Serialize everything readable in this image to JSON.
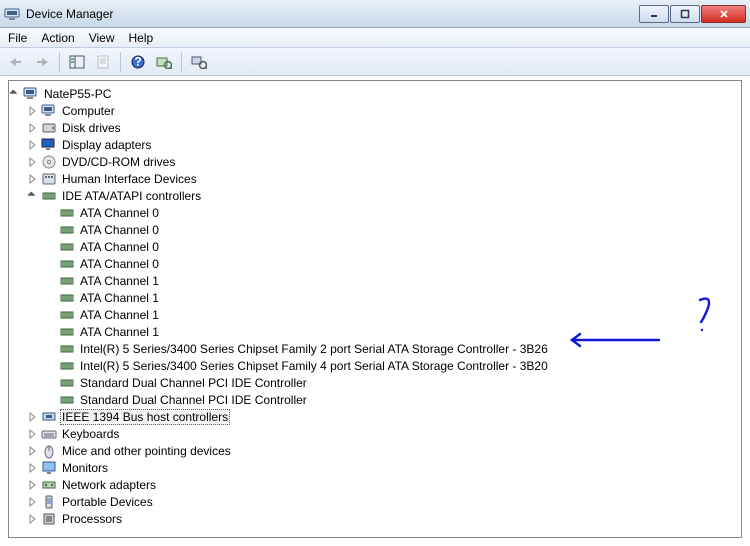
{
  "window": {
    "title": "Device Manager"
  },
  "menubar": {
    "items": [
      "File",
      "Action",
      "View",
      "Help"
    ]
  },
  "toolbar": {
    "back": "Back",
    "forward": "Forward",
    "show_hide": "Show/Hide Console Tree",
    "properties": "Properties",
    "help": "Help",
    "scan": "Scan for hardware changes",
    "view_devices": "View"
  },
  "tree": {
    "root": {
      "label": "NateP55-PC",
      "icon": "computer"
    },
    "nodes": [
      {
        "label": "Computer",
        "icon": "computer",
        "expanded": false
      },
      {
        "label": "Disk drives",
        "icon": "disk",
        "expanded": false
      },
      {
        "label": "Display adapters",
        "icon": "display",
        "expanded": false
      },
      {
        "label": "DVD/CD-ROM drives",
        "icon": "dvd",
        "expanded": false
      },
      {
        "label": "Human Interface Devices",
        "icon": "hid",
        "expanded": false
      },
      {
        "label": "IDE ATA/ATAPI controllers",
        "icon": "ide",
        "expanded": true,
        "children": [
          {
            "label": "ATA Channel 0",
            "icon": "ide"
          },
          {
            "label": "ATA Channel 0",
            "icon": "ide"
          },
          {
            "label": "ATA Channel 0",
            "icon": "ide"
          },
          {
            "label": "ATA Channel 0",
            "icon": "ide"
          },
          {
            "label": "ATA Channel 1",
            "icon": "ide"
          },
          {
            "label": "ATA Channel 1",
            "icon": "ide"
          },
          {
            "label": "ATA Channel 1",
            "icon": "ide"
          },
          {
            "label": "ATA Channel 1",
            "icon": "ide"
          },
          {
            "label": "Intel(R) 5 Series/3400 Series Chipset Family 2 port Serial ATA Storage Controller - 3B26",
            "icon": "ide"
          },
          {
            "label": "Intel(R) 5 Series/3400 Series Chipset Family 4 port Serial ATA Storage Controller - 3B20",
            "icon": "ide"
          },
          {
            "label": "Standard Dual Channel PCI IDE Controller",
            "icon": "ide"
          },
          {
            "label": "Standard Dual Channel PCI IDE Controller",
            "icon": "ide"
          }
        ]
      },
      {
        "label": "IEEE 1394 Bus host controllers",
        "icon": "ieee1394",
        "expanded": false,
        "selected": true
      },
      {
        "label": "Keyboards",
        "icon": "keyboard",
        "expanded": false
      },
      {
        "label": "Mice and other pointing devices",
        "icon": "mouse",
        "expanded": false
      },
      {
        "label": "Monitors",
        "icon": "monitor",
        "expanded": false
      },
      {
        "label": "Network adapters",
        "icon": "network",
        "expanded": false
      },
      {
        "label": "Portable Devices",
        "icon": "portable",
        "expanded": false
      },
      {
        "label": "Processors",
        "icon": "processor",
        "expanded": false
      }
    ]
  },
  "annotation": {
    "color": "#1018d8"
  }
}
